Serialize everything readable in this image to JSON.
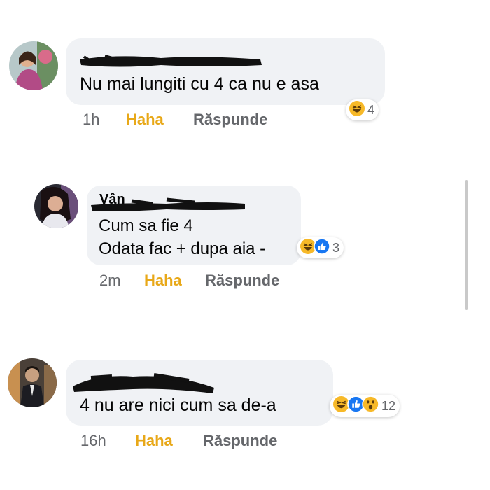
{
  "comments": [
    {
      "text_lines": [
        "Nu mai lungiti cu 4 ca nu e asa"
      ],
      "time": "1h",
      "reaction_label": "Haha",
      "reply_label": "Răspunde",
      "reactions": {
        "icons": [
          "haha-icon"
        ],
        "count": "4"
      }
    },
    {
      "author_fragment": "Vân",
      "text_lines": [
        "Cum sa fie 4",
        "Odata fac + dupa aia -"
      ],
      "time": "2m",
      "reaction_label": "Haha",
      "reply_label": "Răspunde",
      "reactions": {
        "icons": [
          "haha-icon",
          "like-icon"
        ],
        "count": "3"
      }
    },
    {
      "text_lines": [
        "4 nu are nici cum sa de-a"
      ],
      "time": "16h",
      "reaction_label": "Haha",
      "reply_label": "Răspunde",
      "reactions": {
        "icons": [
          "haha-icon",
          "like-icon",
          "wow-icon"
        ],
        "count": "12"
      }
    }
  ],
  "colors": {
    "bubble": "#f0f2f5",
    "haha_label": "#e8a818",
    "meta_gray": "#65676b",
    "like_blue": "#1877f2",
    "emoji_yellow": "#f7b928"
  }
}
